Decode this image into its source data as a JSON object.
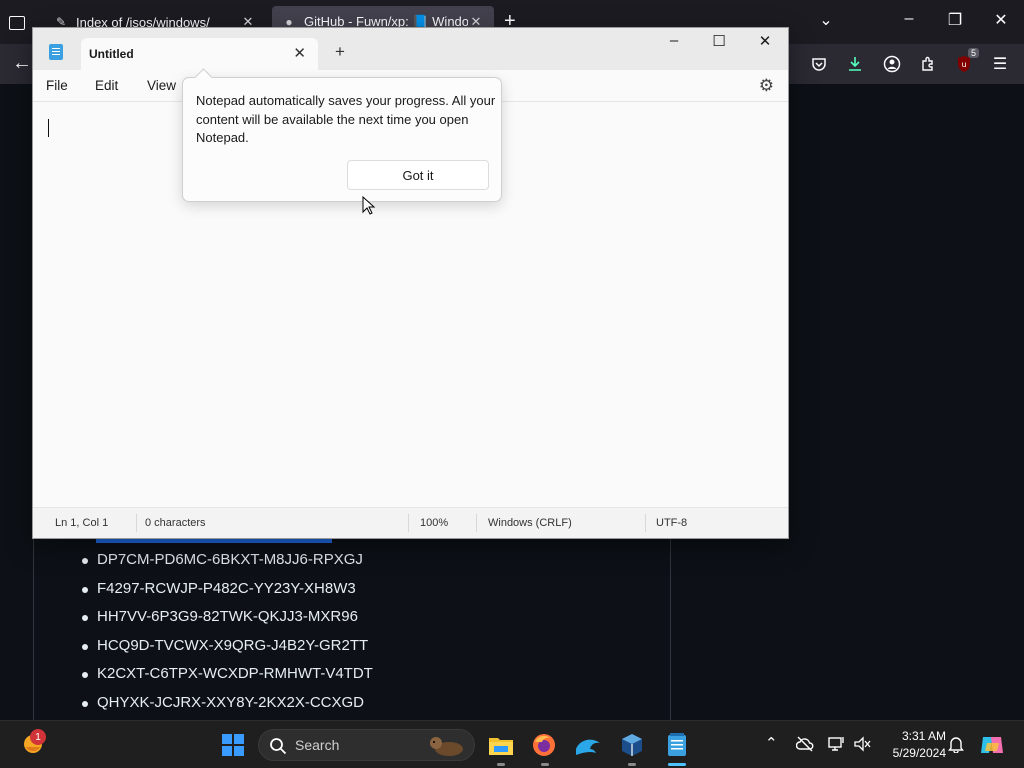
{
  "browser": {
    "tabs": [
      {
        "title": "Index of /isos/windows/",
        "active": false
      },
      {
        "title": "GitHub - Fuwn/xp: 📘 Window",
        "active": true
      }
    ],
    "toolbar_badge": "5"
  },
  "page": {
    "product_keys": [
      "DP7CM-PD6MC-6BKXT-M8JJ6-RPXGJ",
      "F4297-RCWJP-P482C-YY23Y-XH8W3",
      "HH7VV-6P3G9-82TWK-QKJJ3-MXR96",
      "HCQ9D-TVCWX-X9QRG-J4B2Y-GR2TT",
      "K2CXT-C6TPX-WCXDP-RMHWT-V4TDT",
      "QHYXK-JCJRX-XXY8Y-2KX2X-CCXGD"
    ]
  },
  "notepad": {
    "tab_title": "Untitled",
    "menu": [
      "File",
      "Edit",
      "View"
    ],
    "popup": {
      "message": "Notepad automatically saves your progress. All your content will be available the next time you open Notepad.",
      "button": "Got it"
    },
    "status": {
      "position": "Ln 1, Col 1",
      "characters": "0 characters",
      "zoom": "100%",
      "line_ending": "Windows (CRLF)",
      "encoding": "UTF-8"
    }
  },
  "taskbar": {
    "widget_badge": "1",
    "search_label": "Search",
    "time": "3:31 AM",
    "date": "5/29/2024"
  }
}
